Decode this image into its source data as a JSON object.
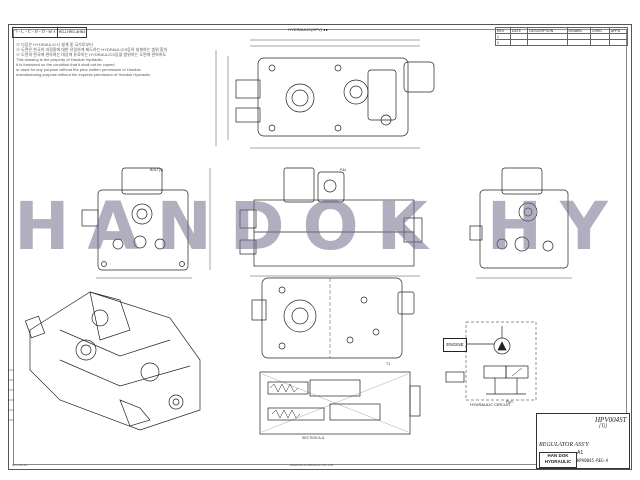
{
  "header": {
    "drawing_code": "ㄱ-ㄴ-ㄷ-ㄹ-ㅁ-ㅂㅅ",
    "drawing_code_sub": "HG-LHRO-AHB4"
  },
  "notes": {
    "lines": [
      "※ 다음은 HYDRAULIC시 설계 및 국가로부터",
      "※ 도면은 한국의 과정중에 대한 유일하게 제도하는 HYDRAULICS등의 설계하는 범위 합의",
      "※ 도면의 한국에 관하여는 대상에 유료하는 HYDRAULICS등을 범위하는 도면에 관하여도",
      "This drawing is the property of Handok Hydraulic.",
      "It is furnished on the condition that it shall not be copied",
      "or used for any purpose without the prior written permission of Handok.",
      "manufacturing purpose without the express permission of Handok Hydraulic."
    ]
  },
  "revision_table": {
    "rows": [
      [
        "REV",
        "DATE",
        "DESCRIPTION",
        "DRAWN",
        "CHKD",
        "APPD"
      ],
      [
        "1",
        "",
        "",
        "",
        "",
        ""
      ],
      [
        "2",
        "",
        "",
        "",
        "",
        ""
      ]
    ]
  },
  "views": {
    "top_title": "HYDRAULIC(HPV)  ●●",
    "front_label": "BOLT(4)",
    "section_label": "SECTION A-A",
    "hydraulic_caption": "HYDRAULIC CIRCUIT",
    "engine_label": "ENGINE",
    "port_label_1": "P&L",
    "port_label_2": "T1",
    "port_label_3": "Ppi1"
  },
  "watermark": "HANDOK HY",
  "title_block": {
    "model": "HPV004ST",
    "model_sub": "[Tj]",
    "part_name": "REGULATOR ASS'Y",
    "company_line1": "HAN DOK",
    "company_line2": "HYDRAULIC",
    "sheet": "A1",
    "drawing_no": "HPV0045-REG-A"
  },
  "footer": {
    "center": "HANDOK HYDRAULIC CO.,LTD",
    "left": "HPV-A1-2A"
  },
  "colors": {
    "line": "#222222",
    "watermark": "#6e6e8c",
    "paper": "#ffffff"
  }
}
